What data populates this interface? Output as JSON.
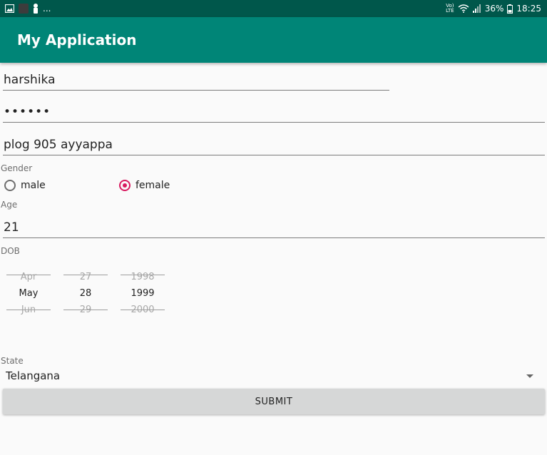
{
  "status_bar": {
    "left_icons": [
      "gallery-icon",
      "app-icon",
      "person-icon"
    ],
    "overflow": "...",
    "network_top": "Vo)",
    "network_bottom": "LTE",
    "battery_percent": "36%",
    "time": "18:25"
  },
  "app_bar": {
    "title": "My Application"
  },
  "form": {
    "name_value": "harshika",
    "password_value": "••••••",
    "address_value": "plog 905 ayyappa",
    "gender_label": "Gender",
    "gender_options": [
      {
        "label": "male",
        "checked": false
      },
      {
        "label": "female",
        "checked": true
      }
    ],
    "age_label": "Age",
    "age_value": "21",
    "dob_label": "DOB",
    "dob_picker": {
      "month": {
        "prev": "Apr",
        "selected": "May",
        "next": "Jun"
      },
      "day": {
        "prev": "27",
        "selected": "28",
        "next": "29"
      },
      "year": {
        "prev": "1998",
        "selected": "1999",
        "next": "2000"
      }
    },
    "state_label": "State",
    "state_value": "Telangana",
    "submit_label": "SUBMIT"
  },
  "colors": {
    "status_bar": "#00574b",
    "app_bar": "#008577",
    "accent": "#d81b60",
    "background": "#fafafa",
    "button": "#d6d7d7"
  }
}
